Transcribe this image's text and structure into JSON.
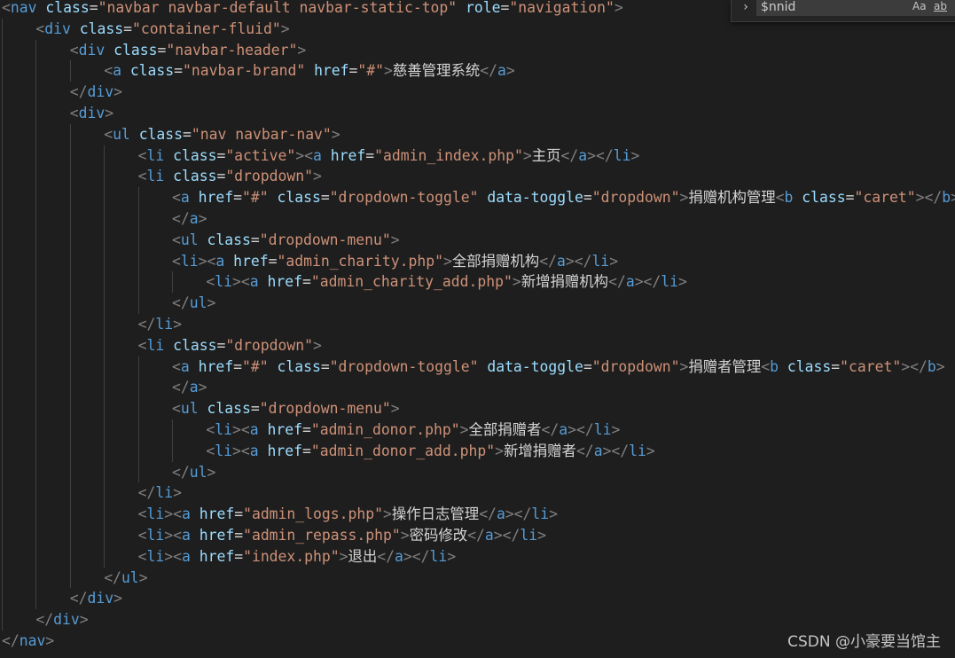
{
  "find_widget": {
    "toggle_icon": "chevron-right-icon",
    "search_value": "$nnid",
    "match_case_label": "Aa",
    "match_word_label": "ab"
  },
  "colors": {
    "background": "#1e1e1e",
    "tag": "#569cd6",
    "attribute": "#9cdcfe",
    "string": "#ce9178",
    "punctuation": "#808080",
    "text": "#d4d4d4"
  },
  "code_lines": [
    {
      "indent": 0,
      "tokens": [
        [
          "p",
          "<"
        ],
        [
          "t",
          "nav"
        ],
        [
          "x",
          " "
        ],
        [
          "a",
          "class"
        ],
        [
          "x",
          "="
        ],
        [
          "v",
          "\"navbar navbar-default navbar-static-top\""
        ],
        [
          "x",
          " "
        ],
        [
          "a",
          "role"
        ],
        [
          "x",
          "="
        ],
        [
          "v",
          "\"navigation\""
        ],
        [
          "p",
          ">"
        ]
      ]
    },
    {
      "indent": 1,
      "tokens": [
        [
          "p",
          "<"
        ],
        [
          "t",
          "div"
        ],
        [
          "x",
          " "
        ],
        [
          "a",
          "class"
        ],
        [
          "x",
          "="
        ],
        [
          "v",
          "\"container-fluid\""
        ],
        [
          "p",
          ">"
        ]
      ]
    },
    {
      "indent": 2,
      "tokens": [
        [
          "p",
          "<"
        ],
        [
          "t",
          "div"
        ],
        [
          "x",
          " "
        ],
        [
          "a",
          "class"
        ],
        [
          "x",
          "="
        ],
        [
          "v",
          "\"navbar-header\""
        ],
        [
          "p",
          ">"
        ]
      ]
    },
    {
      "indent": 3,
      "tokens": [
        [
          "p",
          "<"
        ],
        [
          "t",
          "a"
        ],
        [
          "x",
          " "
        ],
        [
          "a",
          "class"
        ],
        [
          "x",
          "="
        ],
        [
          "v",
          "\"navbar-brand\""
        ],
        [
          "x",
          " "
        ],
        [
          "a",
          "href"
        ],
        [
          "x",
          "="
        ],
        [
          "v",
          "\"#\""
        ],
        [
          "p",
          ">"
        ],
        [
          "x",
          "慈善管理系统"
        ],
        [
          "p",
          "</"
        ],
        [
          "t",
          "a"
        ],
        [
          "p",
          ">"
        ]
      ]
    },
    {
      "indent": 2,
      "tokens": [
        [
          "p",
          "</"
        ],
        [
          "t",
          "div"
        ],
        [
          "p",
          ">"
        ]
      ]
    },
    {
      "indent": 2,
      "tokens": [
        [
          "p",
          "<"
        ],
        [
          "t",
          "div"
        ],
        [
          "p",
          ">"
        ]
      ]
    },
    {
      "indent": 3,
      "tokens": [
        [
          "p",
          "<"
        ],
        [
          "t",
          "ul"
        ],
        [
          "x",
          " "
        ],
        [
          "a",
          "class"
        ],
        [
          "x",
          "="
        ],
        [
          "v",
          "\"nav navbar-nav\""
        ],
        [
          "p",
          ">"
        ]
      ]
    },
    {
      "indent": 4,
      "tokens": [
        [
          "p",
          "<"
        ],
        [
          "t",
          "li"
        ],
        [
          "x",
          " "
        ],
        [
          "a",
          "class"
        ],
        [
          "x",
          "="
        ],
        [
          "v",
          "\"active\""
        ],
        [
          "p",
          "><"
        ],
        [
          "t",
          "a"
        ],
        [
          "x",
          " "
        ],
        [
          "a",
          "href"
        ],
        [
          "x",
          "="
        ],
        [
          "v",
          "\"admin_index.php\""
        ],
        [
          "p",
          ">"
        ],
        [
          "x",
          "主页"
        ],
        [
          "p",
          "</"
        ],
        [
          "t",
          "a"
        ],
        [
          "p",
          "></"
        ],
        [
          "t",
          "li"
        ],
        [
          "p",
          ">"
        ]
      ]
    },
    {
      "indent": 4,
      "tokens": [
        [
          "p",
          "<"
        ],
        [
          "t",
          "li"
        ],
        [
          "x",
          " "
        ],
        [
          "a",
          "class"
        ],
        [
          "x",
          "="
        ],
        [
          "v",
          "\"dropdown\""
        ],
        [
          "p",
          ">"
        ]
      ]
    },
    {
      "indent": 5,
      "tokens": [
        [
          "p",
          "<"
        ],
        [
          "t",
          "a"
        ],
        [
          "x",
          " "
        ],
        [
          "a",
          "href"
        ],
        [
          "x",
          "="
        ],
        [
          "v",
          "\"#\""
        ],
        [
          "x",
          " "
        ],
        [
          "a",
          "class"
        ],
        [
          "x",
          "="
        ],
        [
          "v",
          "\"dropdown-toggle\""
        ],
        [
          "x",
          " "
        ],
        [
          "a",
          "data-toggle"
        ],
        [
          "x",
          "="
        ],
        [
          "v",
          "\"dropdown\""
        ],
        [
          "p",
          ">"
        ],
        [
          "x",
          "捐赠机构管理"
        ],
        [
          "p",
          "<"
        ],
        [
          "t",
          "b"
        ],
        [
          "x",
          " "
        ],
        [
          "a",
          "class"
        ],
        [
          "x",
          "="
        ],
        [
          "v",
          "\"caret\""
        ],
        [
          "p",
          "></"
        ],
        [
          "t",
          "b"
        ],
        [
          "p",
          ">"
        ]
      ]
    },
    {
      "indent": 5,
      "tokens": [
        [
          "p",
          "</"
        ],
        [
          "t",
          "a"
        ],
        [
          "p",
          ">"
        ]
      ]
    },
    {
      "indent": 5,
      "tokens": [
        [
          "p",
          "<"
        ],
        [
          "t",
          "ul"
        ],
        [
          "x",
          " "
        ],
        [
          "a",
          "class"
        ],
        [
          "x",
          "="
        ],
        [
          "v",
          "\"dropdown-menu\""
        ],
        [
          "p",
          ">"
        ]
      ]
    },
    {
      "indent": 5,
      "tokens": [
        [
          "p",
          "<"
        ],
        [
          "t",
          "li"
        ],
        [
          "p",
          "><"
        ],
        [
          "t",
          "a"
        ],
        [
          "x",
          " "
        ],
        [
          "a",
          "href"
        ],
        [
          "x",
          "="
        ],
        [
          "v",
          "\"admin_charity.php\""
        ],
        [
          "p",
          ">"
        ],
        [
          "x",
          "全部捐赠机构"
        ],
        [
          "p",
          "</"
        ],
        [
          "t",
          "a"
        ],
        [
          "p",
          "></"
        ],
        [
          "t",
          "li"
        ],
        [
          "p",
          ">"
        ]
      ]
    },
    {
      "indent": 6,
      "tokens": [
        [
          "p",
          "<"
        ],
        [
          "t",
          "li"
        ],
        [
          "p",
          "><"
        ],
        [
          "t",
          "a"
        ],
        [
          "x",
          " "
        ],
        [
          "a",
          "href"
        ],
        [
          "x",
          "="
        ],
        [
          "v",
          "\"admin_charity_add.php\""
        ],
        [
          "p",
          ">"
        ],
        [
          "x",
          "新增捐赠机构"
        ],
        [
          "p",
          "</"
        ],
        [
          "t",
          "a"
        ],
        [
          "p",
          "></"
        ],
        [
          "t",
          "li"
        ],
        [
          "p",
          ">"
        ]
      ]
    },
    {
      "indent": 5,
      "tokens": [
        [
          "p",
          "</"
        ],
        [
          "t",
          "ul"
        ],
        [
          "p",
          ">"
        ]
      ]
    },
    {
      "indent": 4,
      "tokens": [
        [
          "p",
          "</"
        ],
        [
          "t",
          "li"
        ],
        [
          "p",
          ">"
        ]
      ]
    },
    {
      "indent": 4,
      "tokens": [
        [
          "p",
          "<"
        ],
        [
          "t",
          "li"
        ],
        [
          "x",
          " "
        ],
        [
          "a",
          "class"
        ],
        [
          "x",
          "="
        ],
        [
          "v",
          "\"dropdown\""
        ],
        [
          "p",
          ">"
        ]
      ]
    },
    {
      "indent": 5,
      "tokens": [
        [
          "p",
          "<"
        ],
        [
          "t",
          "a"
        ],
        [
          "x",
          " "
        ],
        [
          "a",
          "href"
        ],
        [
          "x",
          "="
        ],
        [
          "v",
          "\"#\""
        ],
        [
          "x",
          " "
        ],
        [
          "a",
          "class"
        ],
        [
          "x",
          "="
        ],
        [
          "v",
          "\"dropdown-toggle\""
        ],
        [
          "x",
          " "
        ],
        [
          "a",
          "data-toggle"
        ],
        [
          "x",
          "="
        ],
        [
          "v",
          "\"dropdown\""
        ],
        [
          "p",
          ">"
        ],
        [
          "x",
          "捐赠者管理"
        ],
        [
          "p",
          "<"
        ],
        [
          "t",
          "b"
        ],
        [
          "x",
          " "
        ],
        [
          "a",
          "class"
        ],
        [
          "x",
          "="
        ],
        [
          "v",
          "\"caret\""
        ],
        [
          "p",
          "></"
        ],
        [
          "t",
          "b"
        ],
        [
          "p",
          ">"
        ]
      ]
    },
    {
      "indent": 5,
      "tokens": [
        [
          "p",
          "</"
        ],
        [
          "t",
          "a"
        ],
        [
          "p",
          ">"
        ]
      ]
    },
    {
      "indent": 5,
      "tokens": [
        [
          "p",
          "<"
        ],
        [
          "t",
          "ul"
        ],
        [
          "x",
          " "
        ],
        [
          "a",
          "class"
        ],
        [
          "x",
          "="
        ],
        [
          "v",
          "\"dropdown-menu\""
        ],
        [
          "p",
          ">"
        ]
      ]
    },
    {
      "indent": 6,
      "tokens": [
        [
          "p",
          "<"
        ],
        [
          "t",
          "li"
        ],
        [
          "p",
          "><"
        ],
        [
          "t",
          "a"
        ],
        [
          "x",
          " "
        ],
        [
          "a",
          "href"
        ],
        [
          "x",
          "="
        ],
        [
          "v",
          "\"admin_donor.php\""
        ],
        [
          "p",
          ">"
        ],
        [
          "x",
          "全部捐赠者"
        ],
        [
          "p",
          "</"
        ],
        [
          "t",
          "a"
        ],
        [
          "p",
          "></"
        ],
        [
          "t",
          "li"
        ],
        [
          "p",
          ">"
        ]
      ]
    },
    {
      "indent": 6,
      "tokens": [
        [
          "p",
          "<"
        ],
        [
          "t",
          "li"
        ],
        [
          "p",
          "><"
        ],
        [
          "t",
          "a"
        ],
        [
          "x",
          " "
        ],
        [
          "a",
          "href"
        ],
        [
          "x",
          "="
        ],
        [
          "v",
          "\"admin_donor_add.php\""
        ],
        [
          "p",
          ">"
        ],
        [
          "x",
          "新增捐赠者"
        ],
        [
          "p",
          "</"
        ],
        [
          "t",
          "a"
        ],
        [
          "p",
          "></"
        ],
        [
          "t",
          "li"
        ],
        [
          "p",
          ">"
        ]
      ]
    },
    {
      "indent": 5,
      "tokens": [
        [
          "p",
          "</"
        ],
        [
          "t",
          "ul"
        ],
        [
          "p",
          ">"
        ]
      ]
    },
    {
      "indent": 4,
      "tokens": [
        [
          "p",
          "</"
        ],
        [
          "t",
          "li"
        ],
        [
          "p",
          ">"
        ]
      ]
    },
    {
      "indent": 4,
      "tokens": [
        [
          "p",
          "<"
        ],
        [
          "t",
          "li"
        ],
        [
          "p",
          "><"
        ],
        [
          "t",
          "a"
        ],
        [
          "x",
          " "
        ],
        [
          "a",
          "href"
        ],
        [
          "x",
          "="
        ],
        [
          "v",
          "\"admin_logs.php\""
        ],
        [
          "p",
          ">"
        ],
        [
          "x",
          "操作日志管理"
        ],
        [
          "p",
          "</"
        ],
        [
          "t",
          "a"
        ],
        [
          "p",
          "></"
        ],
        [
          "t",
          "li"
        ],
        [
          "p",
          ">"
        ]
      ]
    },
    {
      "indent": 4,
      "tokens": [
        [
          "p",
          "<"
        ],
        [
          "t",
          "li"
        ],
        [
          "p",
          "><"
        ],
        [
          "t",
          "a"
        ],
        [
          "x",
          " "
        ],
        [
          "a",
          "href"
        ],
        [
          "x",
          "="
        ],
        [
          "v",
          "\"admin_repass.php\""
        ],
        [
          "p",
          ">"
        ],
        [
          "x",
          "密码修改"
        ],
        [
          "p",
          "</"
        ],
        [
          "t",
          "a"
        ],
        [
          "p",
          "></"
        ],
        [
          "t",
          "li"
        ],
        [
          "p",
          ">"
        ]
      ]
    },
    {
      "indent": 4,
      "tokens": [
        [
          "p",
          "<"
        ],
        [
          "t",
          "li"
        ],
        [
          "p",
          "><"
        ],
        [
          "t",
          "a"
        ],
        [
          "x",
          " "
        ],
        [
          "a",
          "href"
        ],
        [
          "x",
          "="
        ],
        [
          "v",
          "\"index.php\""
        ],
        [
          "p",
          ">"
        ],
        [
          "x",
          "退出"
        ],
        [
          "p",
          "</"
        ],
        [
          "t",
          "a"
        ],
        [
          "p",
          "></"
        ],
        [
          "t",
          "li"
        ],
        [
          "p",
          ">"
        ]
      ]
    },
    {
      "indent": 3,
      "tokens": [
        [
          "p",
          "</"
        ],
        [
          "t",
          "ul"
        ],
        [
          "p",
          ">"
        ]
      ]
    },
    {
      "indent": 2,
      "tokens": [
        [
          "p",
          "</"
        ],
        [
          "t",
          "div"
        ],
        [
          "p",
          ">"
        ]
      ]
    },
    {
      "indent": 1,
      "tokens": [
        [
          "p",
          "</"
        ],
        [
          "t",
          "div"
        ],
        [
          "p",
          ">"
        ]
      ]
    },
    {
      "indent": 0,
      "tokens": [
        [
          "p",
          "</"
        ],
        [
          "t",
          "nav"
        ],
        [
          "p",
          ">"
        ]
      ]
    }
  ],
  "watermark": "CSDN @小豪要当馆主"
}
